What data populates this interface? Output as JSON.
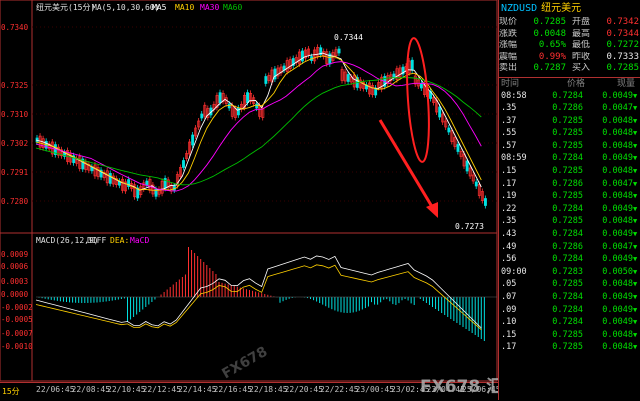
{
  "main_header": {
    "symbol": "纽元美元(15分)",
    "ma_label": "MA(5,10,30,60)",
    "ma5": "MA5",
    "ma10": "MA10",
    "ma30": "MA30",
    "ma60": "MA60"
  },
  "price_axis": [
    "0.7340",
    "0.7325",
    "0.7310",
    "0.7302",
    "0.7291",
    "0.7280"
  ],
  "annotations": {
    "high": "0.7344",
    "low": "0.7273"
  },
  "macd_header": {
    "label": "MACD(26,12,9)",
    "diff": "DIFF",
    "dea": "DEA:",
    "macd": "MaCD"
  },
  "macd_axis": [
    "0.0009",
    "0.0006",
    "0.0003",
    "0.0000",
    "-0.0002",
    "-0.0005",
    "-0.0007",
    "-0.0010"
  ],
  "time_axis": [
    "22/06:45",
    "22/08:45",
    "22/10:45",
    "22/12:45",
    "22/14:45",
    "22/16:45",
    "22/18:45",
    "22/20:45",
    "22/22:45",
    "23/00:45",
    "23/02:45",
    "23/04:45",
    "25/06:45"
  ],
  "timeframe": "15分",
  "panel": {
    "symbol": "NZDUSD",
    "name": "纽元美元",
    "quotes": [
      {
        "l1": "现价",
        "v1": "0.7285",
        "c1": "green",
        "l2": "开盘",
        "v2": "0.7342",
        "c2": "red"
      },
      {
        "l1": "涨跌",
        "v1": "0.0048",
        "c1": "green",
        "l2": "最高",
        "v2": "0.7344",
        "c2": "red"
      },
      {
        "l1": "涨幅",
        "v1": "0.65%",
        "c1": "green",
        "l2": "最低",
        "v2": "0.7272",
        "c2": "green"
      },
      {
        "l1": "震幅",
        "v1": "0.99%",
        "c1": "red",
        "l2": "昨收",
        "v2": "0.7333",
        "c2": "white"
      },
      {
        "l1": "卖出",
        "v1": "0.7287",
        "c1": "green",
        "l2": "买入",
        "v2": "0.7285",
        "c2": "green"
      }
    ],
    "tick_header": {
      "time": "时间",
      "price": "价格",
      "vol": "现量"
    },
    "ticks": [
      {
        "t": "08:58",
        "p": "0.7284",
        "v": "0.0049"
      },
      {
        "t": ".35",
        "p": "0.7286",
        "v": "0.0047"
      },
      {
        "t": ".37",
        "p": "0.7285",
        "v": "0.0048"
      },
      {
        "t": ".55",
        "p": "0.7285",
        "v": "0.0048"
      },
      {
        "t": ".57",
        "p": "0.7285",
        "v": "0.0048"
      },
      {
        "t": "08:59",
        "p": "0.7284",
        "v": "0.0049"
      },
      {
        "t": ".15",
        "p": "0.7285",
        "v": "0.0048"
      },
      {
        "t": ".17",
        "p": "0.7286",
        "v": "0.0047"
      },
      {
        "t": ".19",
        "p": "0.7285",
        "v": "0.0048"
      },
      {
        "t": ".22",
        "p": "0.7284",
        "v": "0.0049"
      },
      {
        "t": ".35",
        "p": "0.7285",
        "v": "0.0048"
      },
      {
        "t": ".43",
        "p": "0.7284",
        "v": "0.0049"
      },
      {
        "t": ".49",
        "p": "0.7286",
        "v": "0.0047"
      },
      {
        "t": ".56",
        "p": "0.7284",
        "v": "0.0049"
      },
      {
        "t": "09:00",
        "p": "0.7283",
        "v": "0.0050"
      },
      {
        "t": ".05",
        "p": "0.7285",
        "v": "0.0048"
      },
      {
        "t": ".07",
        "p": "0.7284",
        "v": "0.0049"
      },
      {
        "t": ".09",
        "p": "0.7284",
        "v": "0.0049"
      },
      {
        "t": ".10",
        "p": "0.7284",
        "v": "0.0049"
      },
      {
        "t": ".15",
        "p": "0.7285",
        "v": "0.0048"
      },
      {
        "t": ".17",
        "p": "0.7285",
        "v": "0.0048"
      }
    ]
  },
  "watermark": "FX678 汇通网",
  "watermark2": "FX678",
  "colors": {
    "up": "#ff3030",
    "down": "#00e0e0",
    "ma5": "#ffffff",
    "ma10": "#ffd000",
    "ma30": "#ff00ff",
    "ma60": "#00c000",
    "border": "#b03030",
    "circle": "#ff2020"
  }
}
